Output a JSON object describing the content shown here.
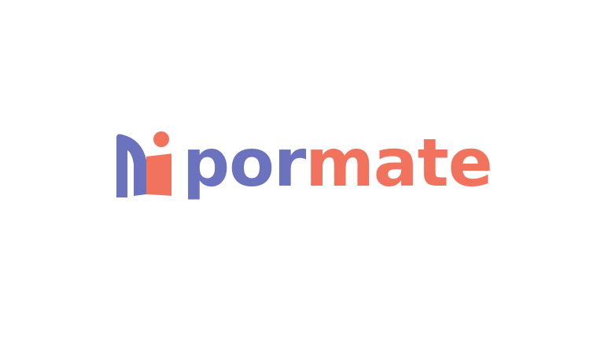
{
  "logo": {
    "word_part_1": "por",
    "word_part_2": "mate",
    "mark_icon": "person-door-icon"
  },
  "colors": {
    "primary": "#6b73bf",
    "accent": "#f2735d",
    "background": "#ffffff"
  }
}
